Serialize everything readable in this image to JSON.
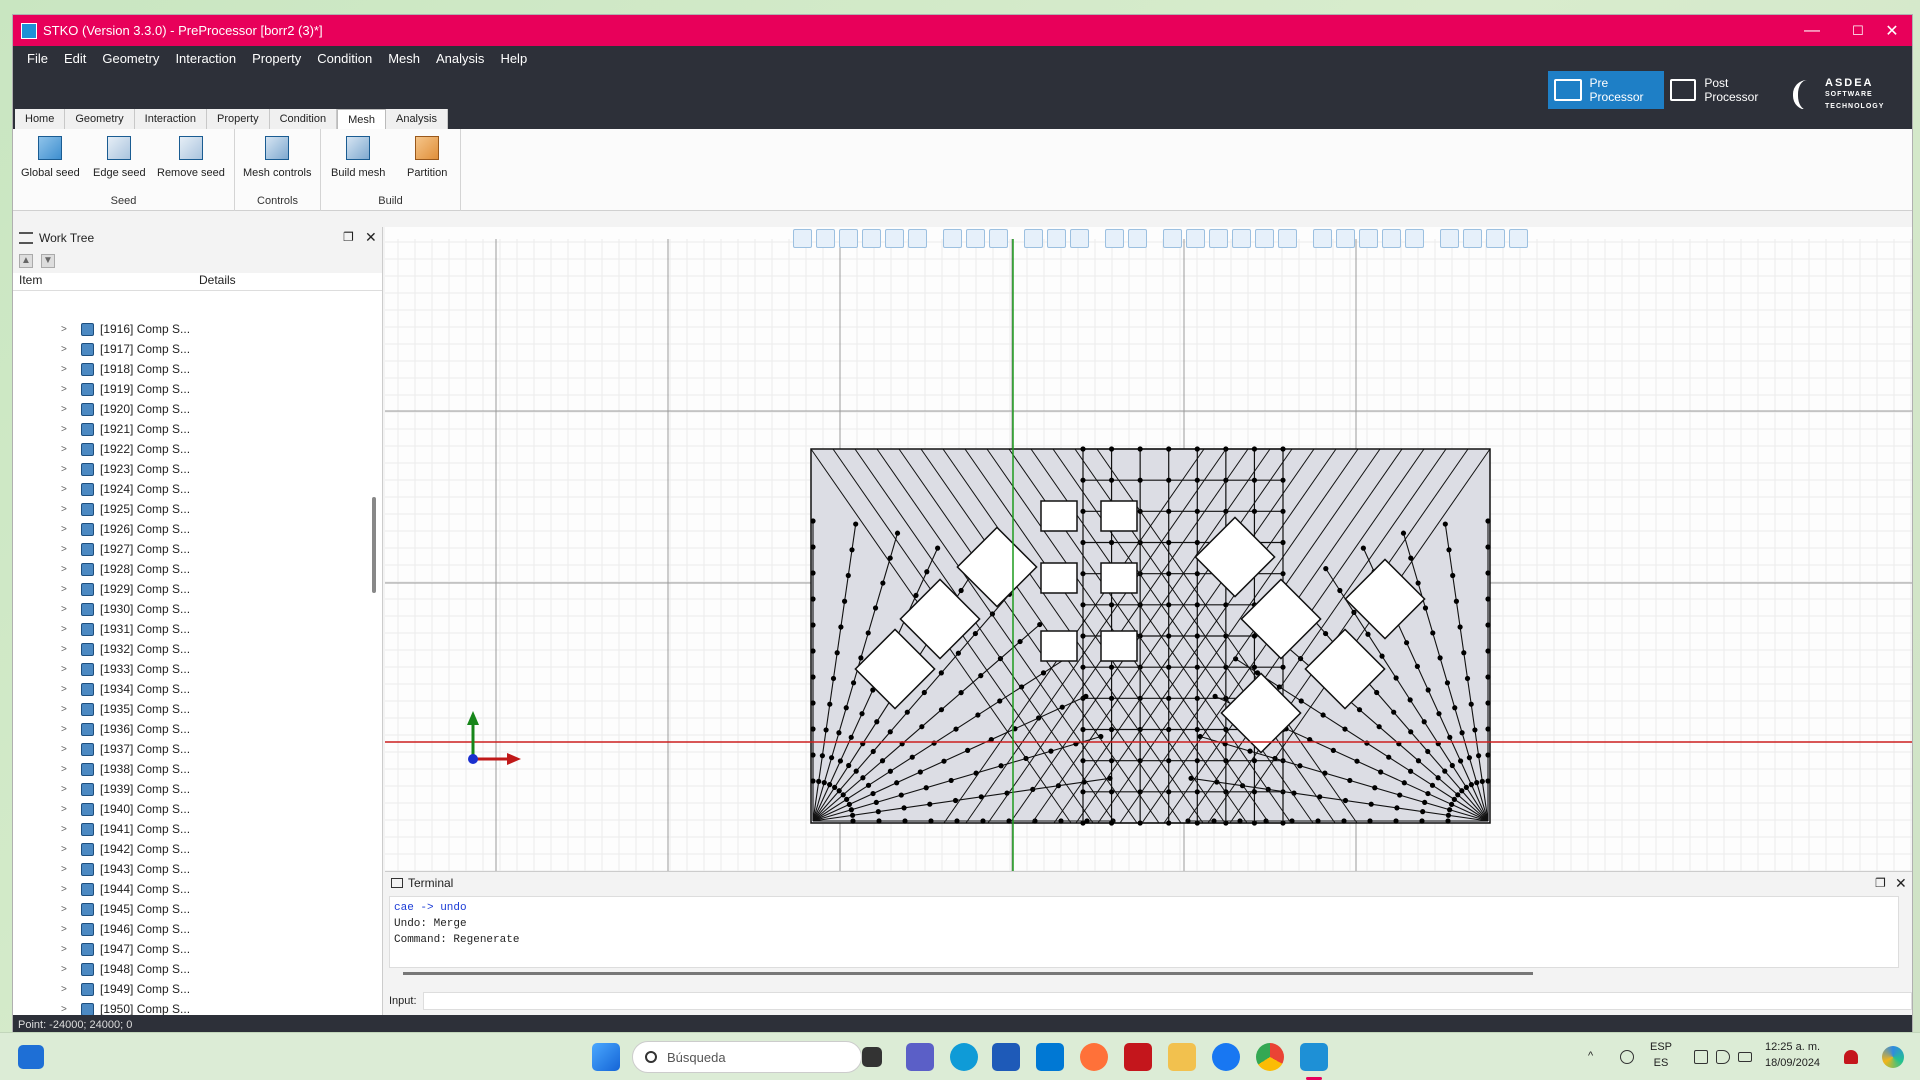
{
  "window": {
    "title": "STKO (Version 3.3.0) - PreProcessor [borr2 (3)*]",
    "controls": {
      "minimize": "—",
      "maximize": "☐",
      "close": "✕"
    }
  },
  "menubar": [
    "File",
    "Edit",
    "Geometry",
    "Interaction",
    "Property",
    "Condition",
    "Mesh",
    "Analysis",
    "Help"
  ],
  "modes": {
    "pre": "Pre Processor",
    "post": "Post Processor"
  },
  "logo": {
    "line1": "ASDEA",
    "line2": "SOFTWARE",
    "line3": "TECHNOLOGY"
  },
  "ribbon_tabs": [
    "Home",
    "Geometry",
    "Interaction",
    "Property",
    "Condition",
    "Mesh",
    "Analysis"
  ],
  "ribbon_active_tab": "Mesh",
  "ribbon": {
    "seed": {
      "label": "Seed",
      "buttons": [
        "Global seed",
        "Edge seed",
        "Remove seed"
      ]
    },
    "controls": {
      "label": "Controls",
      "buttons": [
        "Mesh controls"
      ]
    },
    "build": {
      "label": "Build",
      "buttons": [
        "Build mesh",
        "Partition"
      ]
    }
  },
  "worktree": {
    "title": "Work Tree",
    "columns": [
      "Item",
      "Details"
    ],
    "items": [
      "[1916] Comp S...",
      "[1917] Comp S...",
      "[1918] Comp S...",
      "[1919] Comp S...",
      "[1920] Comp S...",
      "[1921] Comp S...",
      "[1922] Comp S...",
      "[1923] Comp S...",
      "[1924] Comp S...",
      "[1925] Comp S...",
      "[1926] Comp S...",
      "[1927] Comp S...",
      "[1928] Comp S...",
      "[1929] Comp S...",
      "[1930] Comp S...",
      "[1931] Comp S...",
      "[1932] Comp S...",
      "[1933] Comp S...",
      "[1934] Comp S...",
      "[1935] Comp S...",
      "[1936] Comp S...",
      "[1937] Comp S...",
      "[1938] Comp S...",
      "[1939] Comp S...",
      "[1940] Comp S...",
      "[1941] Comp S...",
      "[1942] Comp S...",
      "[1943] Comp S...",
      "[1944] Comp S...",
      "[1945] Comp S...",
      "[1946] Comp S...",
      "[1947] Comp S...",
      "[1948] Comp S...",
      "[1949] Comp S...",
      "[1950] Comp S..."
    ]
  },
  "terminal": {
    "title": "Terminal",
    "lines": [
      "cae -> undo",
      "Undo: Merge",
      "Command: Regenerate"
    ],
    "input_label": "Input:"
  },
  "statusbar": {
    "text": "Point: -24000; 24000; 0"
  },
  "taskbar": {
    "search_placeholder": "Búsqueda",
    "lang_line1": "ESP",
    "lang_line2": "ES",
    "time": "12:25 a. m.",
    "date": "18/09/2024"
  },
  "colors": {
    "titlebar": "#e8005a",
    "menubar": "#2d3039",
    "accent": "#1e7fc6",
    "mesh_fill": "#dcdde4",
    "x_axis": "#cc1f1f",
    "y_axis": "#1f9b1f"
  }
}
